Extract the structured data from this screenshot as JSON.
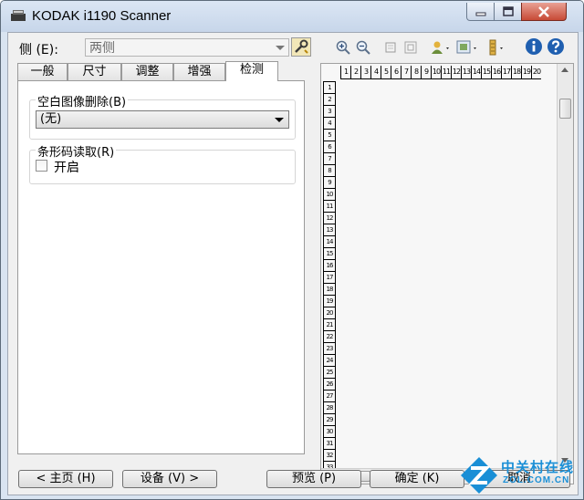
{
  "window": {
    "title": "KODAK i1190 Scanner"
  },
  "toolbar": {
    "side_label": "侧 (E):",
    "side_value": "两侧",
    "icons": [
      "settings-icon",
      "zoom-in-icon",
      "zoom-out-icon",
      "rotate-icon",
      "fit-icon",
      "user-icon",
      "image-icon",
      "bar-icon",
      "info-icon",
      "help-icon"
    ]
  },
  "tabs": [
    {
      "label": "一般"
    },
    {
      "label": "尺寸"
    },
    {
      "label": "调整"
    },
    {
      "label": "增强"
    },
    {
      "label": "检测",
      "active": true
    }
  ],
  "blank_image": {
    "title": "空白图像删除(B)",
    "value": "(无)"
  },
  "barcode": {
    "title": "条形码读取(R)",
    "checkbox_label": "开启",
    "checked": false
  },
  "preview": {
    "ruler_top": [
      "1",
      "2",
      "3",
      "4",
      "5",
      "6",
      "7",
      "8",
      "9",
      "10",
      "11",
      "12",
      "13",
      "14",
      "15",
      "16",
      "17",
      "18",
      "19",
      "20"
    ],
    "ruler_left": [
      "1",
      "2",
      "3",
      "4",
      "5",
      "6",
      "7",
      "8",
      "9",
      "10",
      "11",
      "12",
      "13",
      "14",
      "15",
      "16",
      "17",
      "18",
      "19",
      "20",
      "21",
      "22",
      "23",
      "24",
      "25",
      "26",
      "27",
      "28",
      "29",
      "30",
      "31",
      "32",
      "33",
      "34"
    ]
  },
  "buttons": {
    "home": "< 主页 (H)",
    "device": "设备 (V) >",
    "preview": "预览 (P)",
    "ok": "确定 (K)",
    "cancel": "取消"
  },
  "watermark": {
    "brand": "中关村在线",
    "site": "ZOL.COM.CN"
  },
  "colors": {
    "close_button": "#c74a36",
    "info_blue": "#1f5fb0",
    "watermark_blue": "#1a8fd6"
  }
}
